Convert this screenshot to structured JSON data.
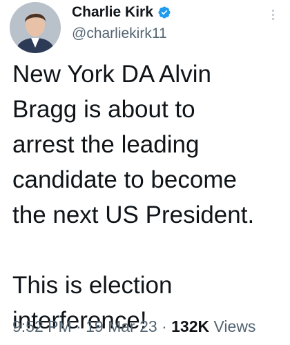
{
  "author": {
    "display_name": "Charlie Kirk",
    "handle": "@charliekirk11",
    "verified": true,
    "verified_icon": "verified-badge-icon",
    "verified_color": "#1d9bf0"
  },
  "tweet": {
    "paragraph_1": [
      "New York DA Alvin",
      "Bragg is about to",
      "arrest the leading",
      "candidate to become",
      "the next US President."
    ],
    "paragraph_2": [
      "This is election",
      "interference!"
    ],
    "time": "9:52 PM",
    "separator": "·",
    "date": "19 Mar 23",
    "views_count": "132K",
    "views_label": "Views"
  },
  "colors": {
    "text": "#0f1419",
    "secondary": "#536471",
    "background": "#ffffff"
  }
}
